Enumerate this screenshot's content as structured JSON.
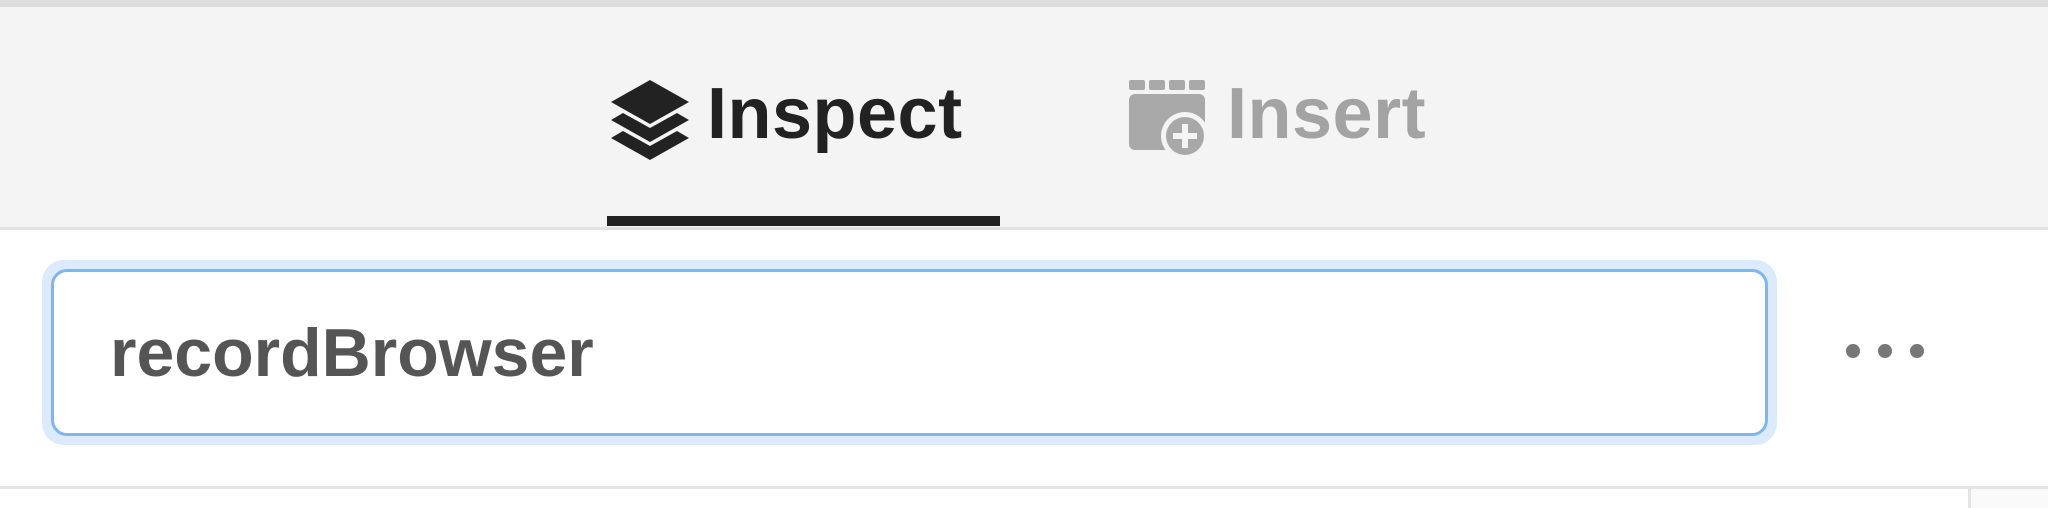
{
  "tabs": [
    {
      "label": "Inspect",
      "icon": "layers-icon",
      "active": true
    },
    {
      "label": "Insert",
      "icon": "insert-component-icon",
      "active": false
    }
  ],
  "component_name_field": {
    "value": "recordBrowser"
  },
  "more_button": {
    "icon": "more-horizontal-icon"
  },
  "colors": {
    "active_tab": "#222222",
    "inactive_tab": "#a3a3a3",
    "focus_ring": "#7fb6f2",
    "tabbar_background": "#f4f4f4"
  }
}
